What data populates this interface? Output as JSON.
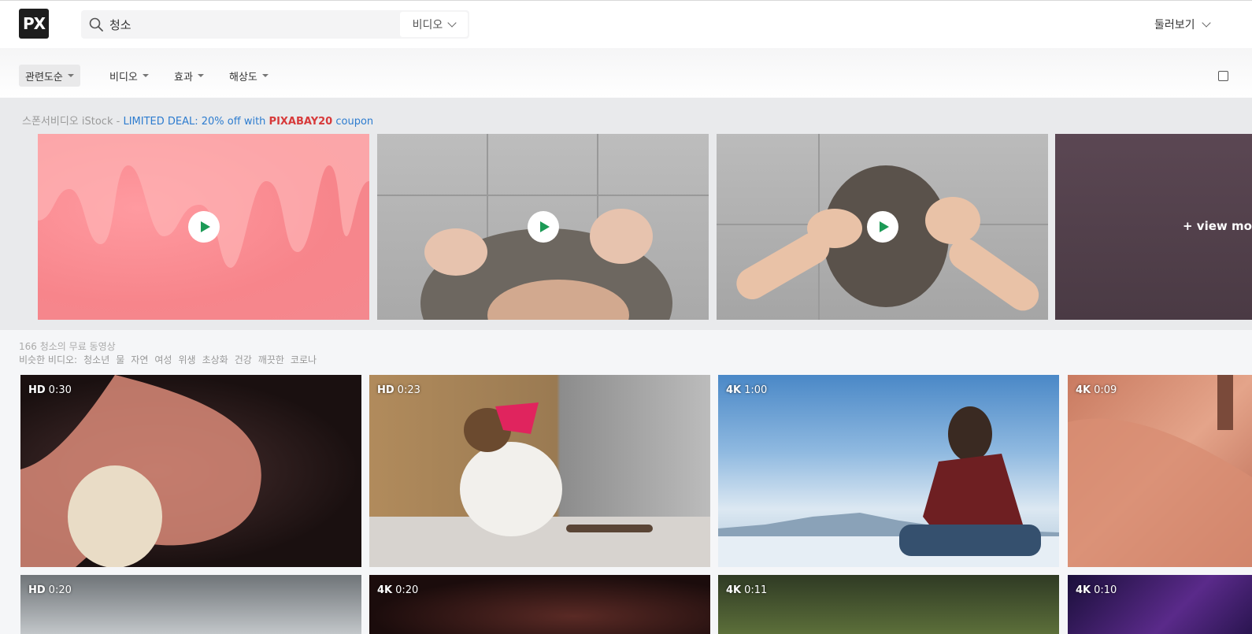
{
  "header": {
    "logo_text": "PX",
    "search_value": "청소",
    "search_type": "비디오",
    "explore_label": "둘러보기"
  },
  "filters": [
    {
      "label": "관련도순"
    },
    {
      "label": "비디오"
    },
    {
      "label": "효과"
    },
    {
      "label": "해상도"
    }
  ],
  "sponsor": {
    "prefix": "스폰서비디오 iStock - ",
    "deal_text": "LIMITED DEAL: 20% off with ",
    "code": "PIXABAY20",
    "suffix": " coupon",
    "view_more": "+ view more"
  },
  "results": {
    "count_text": "166 청소의 무료 동영상",
    "similar_label": "비슷한 비디오:",
    "similar_tags": [
      "청소년",
      "물",
      "자연",
      "여성",
      "위생",
      "초상화",
      "건강",
      "깨끗한",
      "코로나"
    ]
  },
  "videos": [
    {
      "quality": "HD",
      "duration": "0:30"
    },
    {
      "quality": "HD",
      "duration": "0:23"
    },
    {
      "quality": "4K",
      "duration": "1:00"
    },
    {
      "quality": "4K",
      "duration": "0:09"
    },
    {
      "quality": "HD",
      "duration": "0:20"
    },
    {
      "quality": "4K",
      "duration": "0:20"
    },
    {
      "quality": "4K",
      "duration": "0:11"
    },
    {
      "quality": "4K",
      "duration": "0:10"
    }
  ]
}
